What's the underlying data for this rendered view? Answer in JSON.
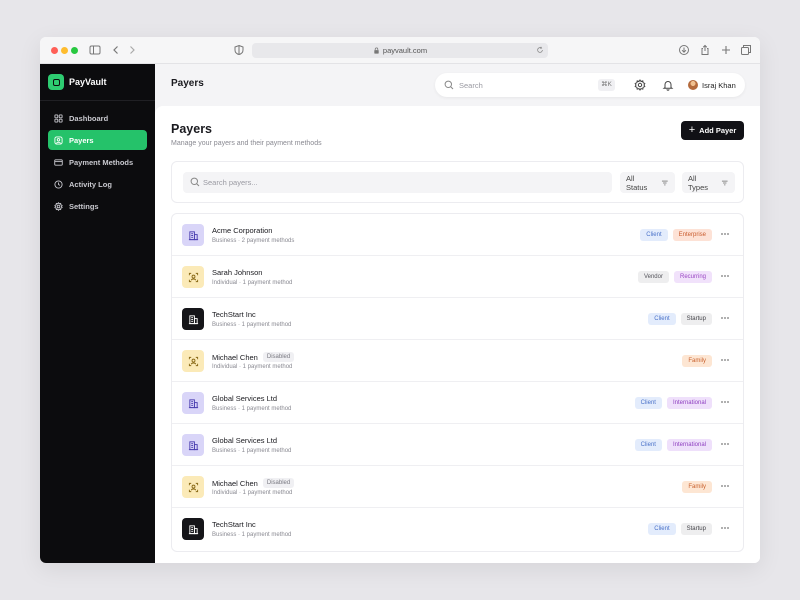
{
  "browser": {
    "url": "payvault.com"
  },
  "app": {
    "name": "PayVault"
  },
  "sidebar": {
    "items": [
      {
        "label": "Dashboard",
        "icon": "grid-icon",
        "active": false
      },
      {
        "label": "Payers",
        "icon": "user-square-icon",
        "active": true
      },
      {
        "label": "Payment Methods",
        "icon": "credit-card-icon",
        "active": false
      },
      {
        "label": "Activity Log",
        "icon": "clock-icon",
        "active": false
      },
      {
        "label": "Settings",
        "icon": "gear-icon",
        "active": false
      }
    ]
  },
  "topbar": {
    "title": "Payers",
    "search_placeholder": "Search",
    "shortcut": "⌘K",
    "user_name": "Israj Khan"
  },
  "page": {
    "title": "Payers",
    "subtitle": "Manage your payers and their payment methods",
    "add_button": "Add Payer"
  },
  "filters": {
    "search_placeholder": "Search payers...",
    "status": "All Status",
    "types": "All Types"
  },
  "payers": [
    {
      "name": "Acme Corporation",
      "meta": "Business · 2 payment methods",
      "type": "business",
      "disabled": "",
      "tags": [
        {
          "label": "Client",
          "kind": "client"
        },
        {
          "label": "Enterprise",
          "kind": "enterprise"
        }
      ]
    },
    {
      "name": "Sarah Johnson",
      "meta": "Individual · 1 payment method",
      "type": "individual",
      "disabled": "",
      "tags": [
        {
          "label": "Vendor",
          "kind": "vendor"
        },
        {
          "label": "Recurring",
          "kind": "recurring"
        }
      ]
    },
    {
      "name": "TechStart Inc",
      "meta": "Business · 1 payment method",
      "type": "dark",
      "disabled": "",
      "tags": [
        {
          "label": "Client",
          "kind": "client"
        },
        {
          "label": "Startup",
          "kind": "startup"
        }
      ]
    },
    {
      "name": "Michael Chen",
      "meta": "Individual · 1 payment method",
      "type": "individual",
      "disabled": "Disabled",
      "tags": [
        {
          "label": "Family",
          "kind": "family"
        }
      ]
    },
    {
      "name": "Global Services Ltd",
      "meta": "Business · 1 payment method",
      "type": "business",
      "disabled": "",
      "tags": [
        {
          "label": "Client",
          "kind": "client"
        },
        {
          "label": "International",
          "kind": "international"
        }
      ]
    },
    {
      "name": "Global Services Ltd",
      "meta": "Business · 1 payment method",
      "type": "business",
      "disabled": "",
      "tags": [
        {
          "label": "Client",
          "kind": "client"
        },
        {
          "label": "International",
          "kind": "international"
        }
      ]
    },
    {
      "name": "Michael Chen",
      "meta": "Individual · 1 payment method",
      "type": "individual",
      "disabled": "Disabled",
      "tags": [
        {
          "label": "Family",
          "kind": "family"
        }
      ]
    },
    {
      "name": "TechStart Inc",
      "meta": "Business · 1 payment method",
      "type": "dark",
      "disabled": "",
      "tags": [
        {
          "label": "Client",
          "kind": "client"
        },
        {
          "label": "Startup",
          "kind": "startup"
        }
      ]
    }
  ],
  "colors": {
    "accent": "#25c26a",
    "sidebar_bg": "#0c0c0e",
    "button_dark": "#111116"
  }
}
